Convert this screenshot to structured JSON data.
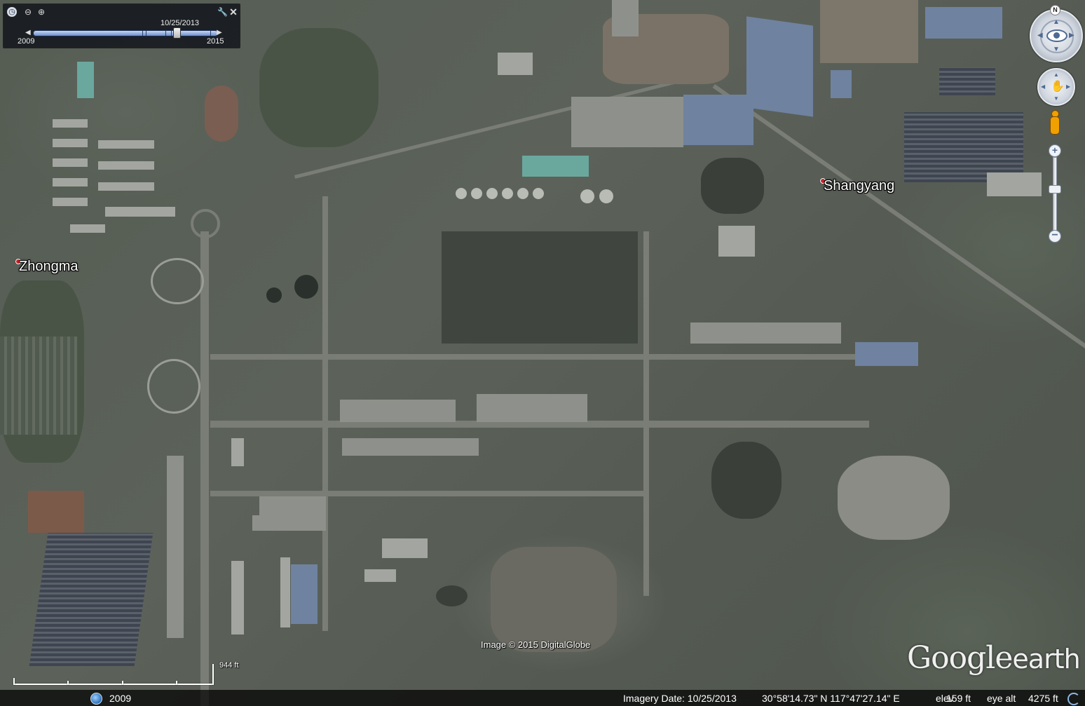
{
  "map": {
    "places": [
      {
        "id": "zhongma",
        "label": "Zhongma"
      },
      {
        "id": "shangyang",
        "label": "Shangyang"
      }
    ],
    "credit": "Image © 2015 DigitalGlobe"
  },
  "time_slider": {
    "selected_date": "10/25/2013",
    "start_year": "2009",
    "end_year": "2015",
    "position": 0.78
  },
  "navigation": {
    "north_label": "N",
    "zoom_level": 0.43
  },
  "logo": {
    "word1": "Google",
    "word2": "earth"
  },
  "scale": {
    "label": "944 ft"
  },
  "status": {
    "tour_year": "2009",
    "imagery_date": "Imagery Date: 10/25/2013",
    "coordinates": "30°58'14.73\" N  117°47'27.14\" E",
    "elev_label": "elev",
    "elev_value": "159 ft",
    "eye_alt_label": "eye alt",
    "eye_alt_value": "4275 ft"
  },
  "colors": {
    "place_dot": "#c8242a",
    "slider_track": "#6d8fcf",
    "nav_accent": "#4f6a92",
    "pegman": "#f0a000"
  },
  "icons": [
    "clock-icon",
    "zoom-out-icon",
    "zoom-in-icon",
    "wrench-icon",
    "close-icon",
    "eye-icon",
    "hand-icon",
    "pegman-icon",
    "globe-icon",
    "streaming-icon"
  ]
}
